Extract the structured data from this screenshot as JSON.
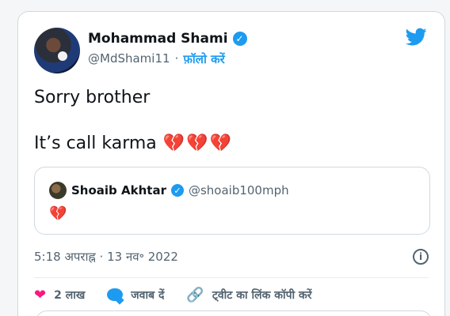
{
  "tweet": {
    "author_name": "Mohammad Shami",
    "handle": "@MdShami11",
    "separator": "·",
    "follow_label": "फ़ॉलो करें",
    "line1": "Sorry brother",
    "line2": "It’s call karma",
    "emoji_line2": "💔💔💔",
    "timestamp": "5:18 अपराह्न · 13 नव॰ 2022"
  },
  "quote": {
    "author_name": "Shoaib Akhtar",
    "handle": "@shoaib100mph",
    "emoji": "💔"
  },
  "actions": {
    "likes": "2 लाख",
    "reply": "जवाब दें",
    "copy_link": "ट्वीट का लिंक कॉपी करें"
  },
  "colors": {
    "brand": "#1d9bf0",
    "like": "#f91880",
    "heart": "#d63b43"
  },
  "icons": {
    "verified": "verified-badge-icon",
    "bird": "twitter-bird-icon",
    "info": "info-icon",
    "heart": "heart-icon",
    "reply": "reply-bubble-icon",
    "link": "link-icon"
  }
}
